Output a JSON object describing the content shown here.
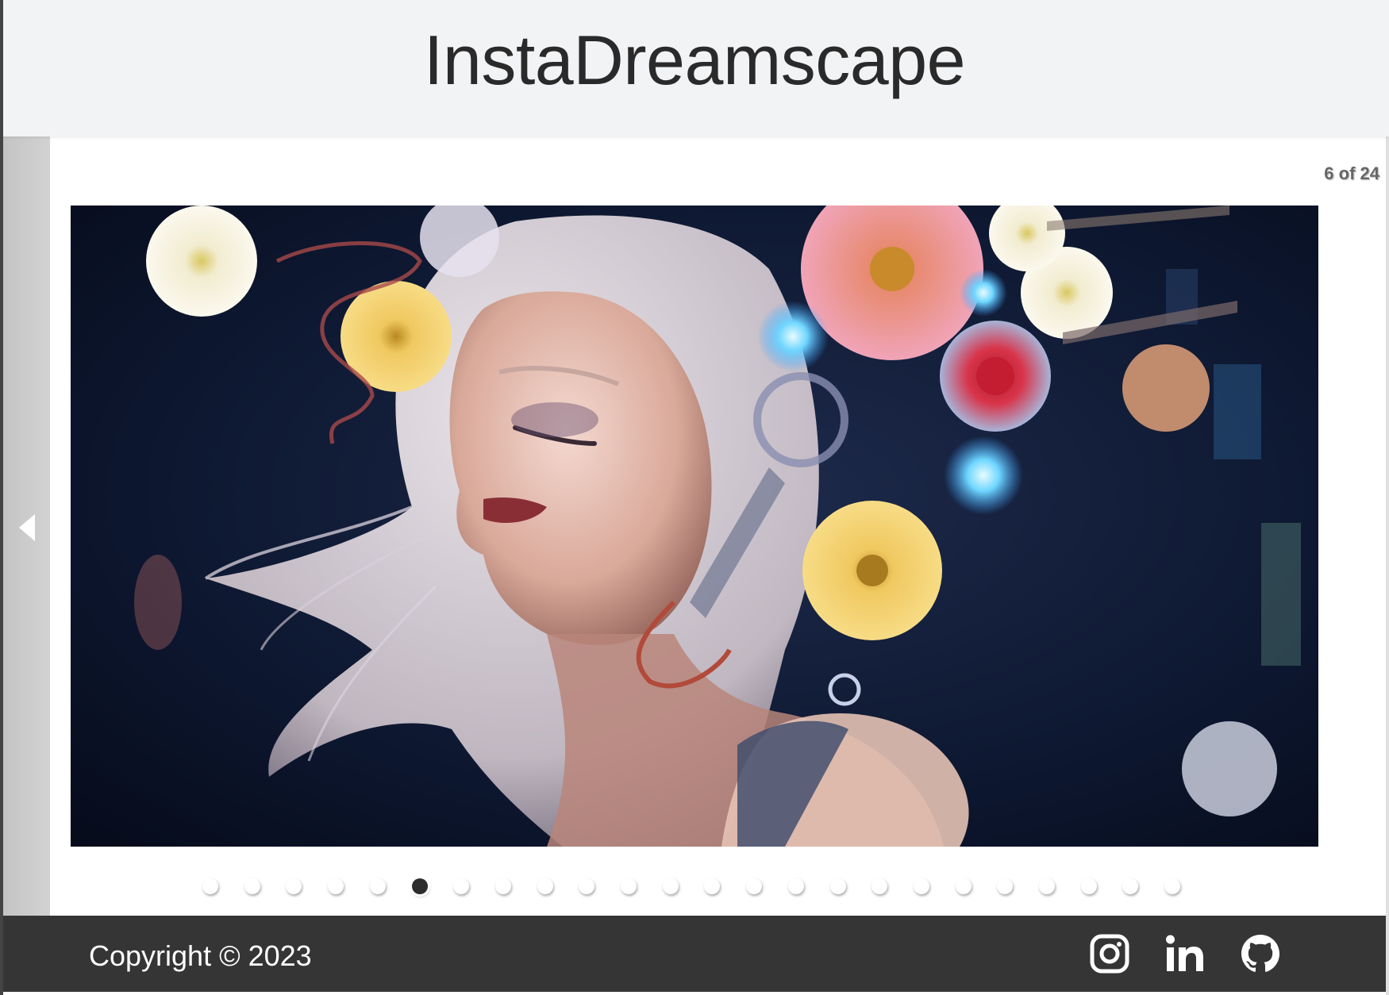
{
  "header": {
    "title": "InstaDreamscape"
  },
  "carousel": {
    "counter": "6 of 24",
    "total_slides": 24,
    "active_index": 6,
    "image_description_icon": "image",
    "prev_icon": "caret-left-icon"
  },
  "footer": {
    "copyright": "Copyright © 2023",
    "social": [
      {
        "name": "instagram-icon"
      },
      {
        "name": "linkedin-icon"
      },
      {
        "name": "github-icon"
      }
    ]
  },
  "colors": {
    "header_bg": "#f2f3f5",
    "footer_bg": "#353535",
    "title": "#2a2a2a"
  }
}
